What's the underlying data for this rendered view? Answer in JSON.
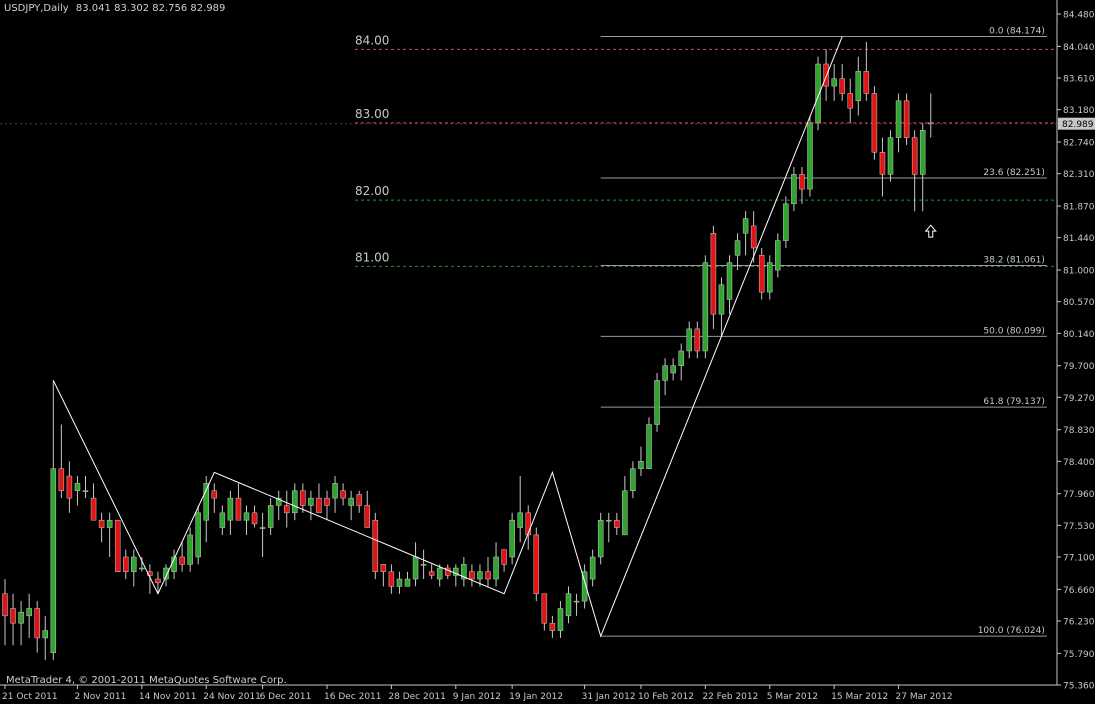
{
  "header": {
    "symbol": "USDJPY,Daily",
    "ohlc": "83.041 83.302 82.756 82.989"
  },
  "footer": {
    "copyright": "MetaTrader 4, © 2001-2011 MetaQuotes Software Corp."
  },
  "colors": {
    "background": "#000000",
    "bull": "#2fa52f",
    "bear": "#e01414",
    "axis": "#c8c8c8",
    "fib_line": "#9a9a9a",
    "level_red": "#c85050",
    "level_green": "#2f8f2f",
    "current_price_bg": "#c8c8c8"
  },
  "chart_data": {
    "type": "candlestick",
    "ylim": [
      75.36,
      84.48
    ],
    "y_ticks": [
      "84.480",
      "84.040",
      "83.610",
      "83.180",
      "82.740",
      "82.310",
      "81.870",
      "81.440",
      "81.000",
      "80.570",
      "80.140",
      "79.700",
      "79.270",
      "78.830",
      "78.400",
      "77.960",
      "77.530",
      "77.100",
      "76.660",
      "76.230",
      "75.790",
      "75.360"
    ],
    "x_ticks": [
      "21 Oct 2011",
      "2 Nov 2011",
      "14 Nov 2011",
      "24 Nov 2011",
      "6 Dec 2011",
      "16 Dec 2011",
      "28 Dec 2011",
      "9 Jan 2012",
      "19 Jan 2012",
      "31 Jan 2012",
      "10 Feb 2012",
      "22 Feb 2012",
      "5 Mar 2012",
      "15 Mar 2012",
      "27 Mar 2012"
    ],
    "current_price": {
      "label": "82.989",
      "value": 82.989
    },
    "price_levels": [
      {
        "label": "84.00",
        "value": 84.0,
        "color": "red"
      },
      {
        "label": "83.00",
        "value": 83.0,
        "color": "red"
      },
      {
        "label": "82.00",
        "value": 81.95,
        "color": "green"
      },
      {
        "label": "81.00",
        "value": 81.05,
        "color": "green"
      }
    ],
    "fib_levels": [
      {
        "label": "0.0 (84.174)",
        "value": 84.174
      },
      {
        "label": "23.6 (82.251)",
        "value": 82.251
      },
      {
        "label": "38.2 (81.061)",
        "value": 81.061
      },
      {
        "label": "50.0 (80.099)",
        "value": 80.099
      },
      {
        "label": "61.8 (79.137)",
        "value": 79.137
      },
      {
        "label": "100.0 (76.024)",
        "value": 76.024
      }
    ],
    "candles": [
      {
        "o": 76.6,
        "h": 76.8,
        "l": 75.9,
        "c": 76.3
      },
      {
        "o": 76.4,
        "h": 76.6,
        "l": 75.9,
        "c": 76.2
      },
      {
        "o": 76.2,
        "h": 76.5,
        "l": 75.9,
        "c": 76.35
      },
      {
        "o": 76.3,
        "h": 76.6,
        "l": 76.0,
        "c": 76.4
      },
      {
        "o": 76.4,
        "h": 76.5,
        "l": 75.8,
        "c": 76.0
      },
      {
        "o": 76.0,
        "h": 76.3,
        "l": 75.7,
        "c": 76.1
      },
      {
        "o": 75.8,
        "h": 79.5,
        "l": 75.7,
        "c": 78.3
      },
      {
        "o": 78.3,
        "h": 78.9,
        "l": 77.9,
        "c": 78.0
      },
      {
        "o": 78.2,
        "h": 78.4,
        "l": 77.7,
        "c": 77.9
      },
      {
        "o": 78.0,
        "h": 78.2,
        "l": 77.8,
        "c": 78.1
      },
      {
        "o": 78.0,
        "h": 78.2,
        "l": 77.9,
        "c": 78.0
      },
      {
        "o": 77.9,
        "h": 78.1,
        "l": 77.6,
        "c": 77.6
      },
      {
        "o": 77.6,
        "h": 77.7,
        "l": 77.3,
        "c": 77.5
      },
      {
        "o": 77.5,
        "h": 77.7,
        "l": 77.1,
        "c": 77.6
      },
      {
        "o": 77.6,
        "h": 77.6,
        "l": 76.9,
        "c": 76.9
      },
      {
        "o": 77.1,
        "h": 77.2,
        "l": 76.8,
        "c": 76.9
      },
      {
        "o": 76.9,
        "h": 77.2,
        "l": 76.7,
        "c": 77.1
      },
      {
        "o": 76.95,
        "h": 77.1,
        "l": 76.9,
        "c": 76.95
      },
      {
        "o": 76.9,
        "h": 77.0,
        "l": 76.6,
        "c": 76.85
      },
      {
        "o": 76.8,
        "h": 76.9,
        "l": 76.6,
        "c": 76.75
      },
      {
        "o": 76.8,
        "h": 77.0,
        "l": 76.7,
        "c": 76.95
      },
      {
        "o": 76.9,
        "h": 77.2,
        "l": 76.8,
        "c": 77.1
      },
      {
        "o": 77.1,
        "h": 77.3,
        "l": 76.9,
        "c": 77.0
      },
      {
        "o": 77.0,
        "h": 77.5,
        "l": 76.9,
        "c": 77.4
      },
      {
        "o": 77.1,
        "h": 77.8,
        "l": 77.0,
        "c": 77.7
      },
      {
        "o": 77.6,
        "h": 78.2,
        "l": 77.3,
        "c": 78.1
      },
      {
        "o": 78.0,
        "h": 78.1,
        "l": 77.7,
        "c": 77.9
      },
      {
        "o": 77.5,
        "h": 77.8,
        "l": 77.4,
        "c": 77.7
      },
      {
        "o": 77.6,
        "h": 78.0,
        "l": 77.4,
        "c": 77.9
      },
      {
        "o": 77.9,
        "h": 78.1,
        "l": 77.6,
        "c": 77.6
      },
      {
        "o": 77.6,
        "h": 77.8,
        "l": 77.4,
        "c": 77.7
      },
      {
        "o": 77.7,
        "h": 77.8,
        "l": 77.5,
        "c": 77.55
      },
      {
        "o": 77.5,
        "h": 77.7,
        "l": 77.1,
        "c": 77.5
      },
      {
        "o": 77.5,
        "h": 77.9,
        "l": 77.4,
        "c": 77.8
      },
      {
        "o": 77.8,
        "h": 78.0,
        "l": 77.6,
        "c": 77.9
      },
      {
        "o": 77.8,
        "h": 78.0,
        "l": 77.5,
        "c": 77.7
      },
      {
        "o": 77.7,
        "h": 78.1,
        "l": 77.6,
        "c": 78.0
      },
      {
        "o": 78.0,
        "h": 78.1,
        "l": 77.7,
        "c": 77.8
      },
      {
        "o": 77.8,
        "h": 78.0,
        "l": 77.6,
        "c": 77.9
      },
      {
        "o": 77.9,
        "h": 78.1,
        "l": 77.7,
        "c": 77.7
      },
      {
        "o": 77.9,
        "h": 78.0,
        "l": 77.6,
        "c": 77.8
      },
      {
        "o": 77.9,
        "h": 78.2,
        "l": 77.7,
        "c": 78.1
      },
      {
        "o": 78.0,
        "h": 78.1,
        "l": 77.8,
        "c": 77.9
      },
      {
        "o": 77.8,
        "h": 78.0,
        "l": 77.6,
        "c": 77.9
      },
      {
        "o": 77.95,
        "h": 78.0,
        "l": 77.7,
        "c": 77.8
      },
      {
        "o": 77.8,
        "h": 78.0,
        "l": 77.5,
        "c": 77.5
      },
      {
        "o": 77.6,
        "h": 77.7,
        "l": 76.8,
        "c": 76.9
      },
      {
        "o": 77.0,
        "h": 77.0,
        "l": 76.7,
        "c": 76.9
      },
      {
        "o": 76.9,
        "h": 77.0,
        "l": 76.6,
        "c": 76.7
      },
      {
        "o": 76.7,
        "h": 76.9,
        "l": 76.6,
        "c": 76.8
      },
      {
        "o": 76.7,
        "h": 76.9,
        "l": 76.7,
        "c": 76.8
      },
      {
        "o": 76.8,
        "h": 77.3,
        "l": 76.7,
        "c": 77.1
      },
      {
        "o": 77.0,
        "h": 77.2,
        "l": 76.8,
        "c": 77.0
      },
      {
        "o": 76.9,
        "h": 77.0,
        "l": 76.8,
        "c": 76.85
      },
      {
        "o": 76.8,
        "h": 77.0,
        "l": 76.7,
        "c": 76.95
      },
      {
        "o": 76.95,
        "h": 77.0,
        "l": 76.8,
        "c": 76.85
      },
      {
        "o": 76.85,
        "h": 77.0,
        "l": 76.7,
        "c": 76.95
      },
      {
        "o": 76.8,
        "h": 77.1,
        "l": 76.7,
        "c": 77.0
      },
      {
        "o": 76.9,
        "h": 77.0,
        "l": 76.7,
        "c": 76.8
      },
      {
        "o": 76.8,
        "h": 77.0,
        "l": 76.7,
        "c": 76.9
      },
      {
        "o": 76.9,
        "h": 77.1,
        "l": 76.7,
        "c": 76.8
      },
      {
        "o": 76.8,
        "h": 77.3,
        "l": 76.7,
        "c": 77.1
      },
      {
        "o": 77.2,
        "h": 77.2,
        "l": 76.9,
        "c": 77.0
      },
      {
        "o": 77.1,
        "h": 77.7,
        "l": 77.0,
        "c": 77.6
      },
      {
        "o": 77.5,
        "h": 78.2,
        "l": 77.3,
        "c": 77.7
      },
      {
        "o": 77.7,
        "h": 77.8,
        "l": 77.2,
        "c": 77.4
      },
      {
        "o": 77.4,
        "h": 77.5,
        "l": 76.5,
        "c": 76.6
      },
      {
        "o": 76.6,
        "h": 76.6,
        "l": 76.1,
        "c": 76.2
      },
      {
        "o": 76.2,
        "h": 76.3,
        "l": 76.0,
        "c": 76.1
      },
      {
        "o": 76.1,
        "h": 76.5,
        "l": 76.0,
        "c": 76.4
      },
      {
        "o": 76.3,
        "h": 76.7,
        "l": 76.2,
        "c": 76.6
      },
      {
        "o": 76.5,
        "h": 76.6,
        "l": 76.3,
        "c": 76.5
      },
      {
        "o": 76.5,
        "h": 77.0,
        "l": 76.4,
        "c": 76.9
      },
      {
        "o": 76.8,
        "h": 77.2,
        "l": 76.7,
        "c": 77.1
      },
      {
        "o": 77.1,
        "h": 77.7,
        "l": 77.0,
        "c": 77.6
      },
      {
        "o": 77.6,
        "h": 77.7,
        "l": 77.3,
        "c": 77.6
      },
      {
        "o": 77.6,
        "h": 77.7,
        "l": 77.4,
        "c": 77.5
      },
      {
        "o": 77.4,
        "h": 78.2,
        "l": 77.4,
        "c": 78.0
      },
      {
        "o": 78.0,
        "h": 78.4,
        "l": 77.9,
        "c": 78.3
      },
      {
        "o": 78.3,
        "h": 78.6,
        "l": 78.2,
        "c": 78.4
      },
      {
        "o": 78.3,
        "h": 79.0,
        "l": 78.3,
        "c": 78.9
      },
      {
        "o": 78.9,
        "h": 79.6,
        "l": 78.8,
        "c": 79.5
      },
      {
        "o": 79.5,
        "h": 79.8,
        "l": 79.3,
        "c": 79.7
      },
      {
        "o": 79.6,
        "h": 79.8,
        "l": 79.5,
        "c": 79.7
      },
      {
        "o": 79.7,
        "h": 80.0,
        "l": 79.5,
        "c": 79.9
      },
      {
        "o": 79.9,
        "h": 80.3,
        "l": 79.8,
        "c": 80.2
      },
      {
        "o": 80.2,
        "h": 80.3,
        "l": 79.8,
        "c": 79.9
      },
      {
        "o": 79.9,
        "h": 81.2,
        "l": 79.8,
        "c": 81.1
      },
      {
        "o": 81.5,
        "h": 81.6,
        "l": 80.2,
        "c": 80.4
      },
      {
        "o": 80.4,
        "h": 80.9,
        "l": 80.1,
        "c": 80.8
      },
      {
        "o": 80.6,
        "h": 81.2,
        "l": 80.4,
        "c": 81.1
      },
      {
        "o": 81.2,
        "h": 81.5,
        "l": 81.0,
        "c": 81.4
      },
      {
        "o": 81.5,
        "h": 81.8,
        "l": 81.2,
        "c": 81.7
      },
      {
        "o": 81.6,
        "h": 81.8,
        "l": 81.1,
        "c": 81.3
      },
      {
        "o": 81.2,
        "h": 81.3,
        "l": 80.6,
        "c": 80.7
      },
      {
        "o": 80.7,
        "h": 81.2,
        "l": 80.6,
        "c": 81.1
      },
      {
        "o": 81.0,
        "h": 81.5,
        "l": 80.9,
        "c": 81.4
      },
      {
        "o": 81.4,
        "h": 82.0,
        "l": 81.3,
        "c": 81.9
      },
      {
        "o": 81.9,
        "h": 82.4,
        "l": 81.8,
        "c": 82.3
      },
      {
        "o": 82.3,
        "h": 82.4,
        "l": 81.9,
        "c": 82.1
      },
      {
        "o": 82.1,
        "h": 83.1,
        "l": 82.0,
        "c": 83.0
      },
      {
        "o": 83.0,
        "h": 83.9,
        "l": 82.9,
        "c": 83.8
      },
      {
        "o": 83.8,
        "h": 84.0,
        "l": 83.3,
        "c": 83.5
      },
      {
        "o": 83.5,
        "h": 83.8,
        "l": 83.3,
        "c": 83.6
      },
      {
        "o": 83.6,
        "h": 83.8,
        "l": 83.3,
        "c": 83.4
      },
      {
        "o": 83.4,
        "h": 83.6,
        "l": 83.0,
        "c": 83.2
      },
      {
        "o": 83.3,
        "h": 83.9,
        "l": 83.1,
        "c": 83.7
      },
      {
        "o": 83.7,
        "h": 84.1,
        "l": 83.3,
        "c": 83.4
      },
      {
        "o": 83.4,
        "h": 83.5,
        "l": 82.5,
        "c": 82.6
      },
      {
        "o": 82.6,
        "h": 82.8,
        "l": 82.0,
        "c": 82.3
      },
      {
        "o": 82.3,
        "h": 82.9,
        "l": 82.2,
        "c": 82.8
      },
      {
        "o": 82.8,
        "h": 83.4,
        "l": 82.6,
        "c": 83.3
      },
      {
        "o": 83.3,
        "h": 83.4,
        "l": 82.7,
        "c": 82.8
      },
      {
        "o": 82.8,
        "h": 82.9,
        "l": 81.8,
        "c": 82.3
      },
      {
        "o": 82.3,
        "h": 83.0,
        "l": 81.8,
        "c": 82.9
      },
      {
        "o": 83.0,
        "h": 83.4,
        "l": 82.8,
        "c": 82.989
      }
    ],
    "zigzag": [
      {
        "i": 6,
        "v": 79.5
      },
      {
        "i": 19,
        "v": 76.6
      },
      {
        "i": 26,
        "v": 78.25
      },
      {
        "i": 62,
        "v": 76.6
      },
      {
        "i": 68,
        "v": 78.25
      },
      {
        "i": 74,
        "v": 76.024
      },
      {
        "i": 104,
        "v": 84.174
      }
    ],
    "fib_x_range": [
      74,
      117
    ],
    "arrow": {
      "i": 115,
      "v": 81.8
    }
  }
}
